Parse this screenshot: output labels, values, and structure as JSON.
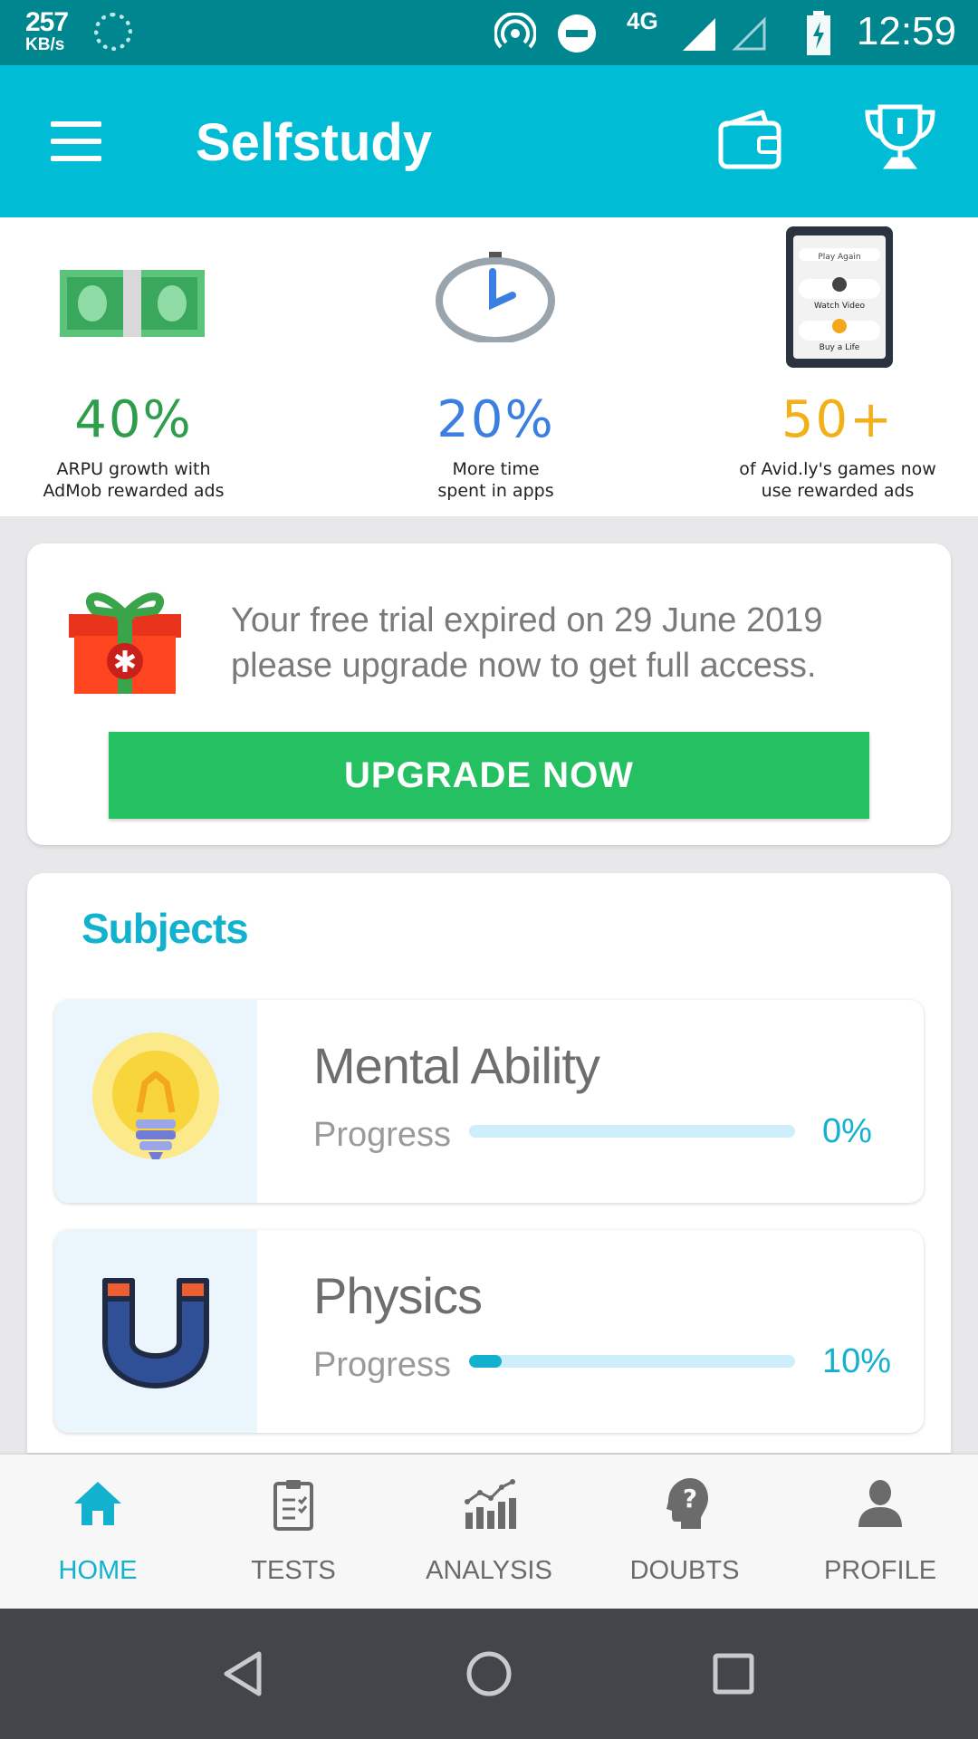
{
  "status_bar": {
    "speed_value": "257",
    "speed_unit": "KB/s",
    "network": "4G",
    "time": "12:59"
  },
  "app_bar": {
    "title": "Selfstudy",
    "icons": [
      "menu-icon",
      "wallet-icon",
      "trophy-icon"
    ]
  },
  "promo": {
    "stats": [
      {
        "value": "40%",
        "caption_line1": "ARPU growth with",
        "caption_line2": "AdMob rewarded ads",
        "color": "#2e9e4c"
      },
      {
        "value": "20%",
        "caption_line1": "More time",
        "caption_line2": "spent in apps",
        "color": "#3b7fe0"
      },
      {
        "value": "50+",
        "caption_line1": "of Avid.ly's games now",
        "caption_line2": "use rewarded ads",
        "color": "#f2b11a"
      }
    ],
    "phone_menu": [
      "Play Again",
      "Watch Video",
      "Buy a Life"
    ]
  },
  "trial": {
    "line1": "Your free trial expired on 29 June 2019",
    "line2": "please upgrade now to get full access.",
    "button_label": "UPGRADE NOW"
  },
  "subjects": {
    "title": "Subjects",
    "items": [
      {
        "name": "Mental Ability",
        "progress_label": "Progress",
        "progress_text": "0%",
        "progress": 0.0
      },
      {
        "name": "Physics",
        "progress_label": "Progress",
        "progress_text": "10%",
        "progress": 0.1
      }
    ]
  },
  "bottom_nav": {
    "items": [
      {
        "label": "HOME",
        "active": true
      },
      {
        "label": "TESTS",
        "active": false
      },
      {
        "label": "ANALYSIS",
        "active": false
      },
      {
        "label": "DOUBTS",
        "active": false
      },
      {
        "label": "PROFILE",
        "active": false
      }
    ]
  },
  "colors": {
    "accent": "#00bcd4",
    "status_bar": "#00868f",
    "upgrade_button": "#24c062",
    "subject_title": "#12b2cf"
  }
}
